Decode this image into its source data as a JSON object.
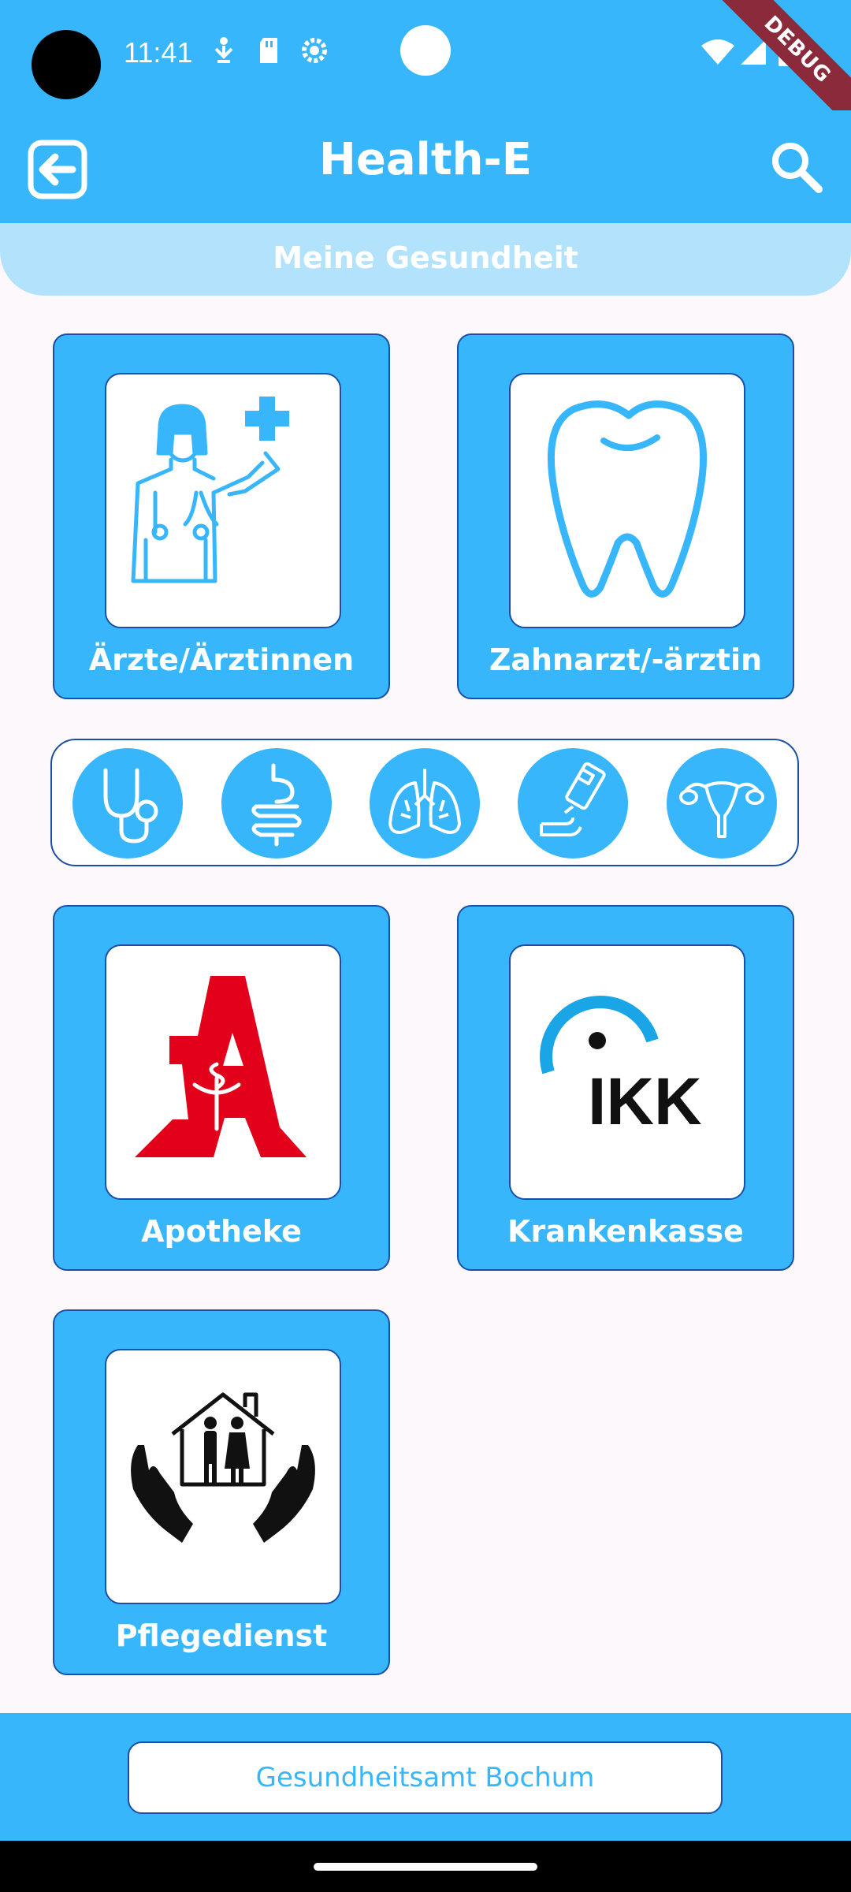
{
  "status_bar": {
    "time": "11:41",
    "debug_label": "DEBUG"
  },
  "app_bar": {
    "title": "Health-E",
    "back_icon": "back-arrow-icon",
    "search_icon": "search-icon"
  },
  "subheader": {
    "title": "Meine Gesundheit"
  },
  "cards": [
    {
      "label": "Ärzte/Ärztinnen",
      "icon": "doctor-icon"
    },
    {
      "label": "Zahnarzt/-ärztin",
      "icon": "tooth-icon"
    },
    {
      "label": "Apotheke",
      "icon": "pharmacy-logo"
    },
    {
      "label": "Krankenkasse",
      "icon": "ikk-logo",
      "logo_text": "IKK"
    },
    {
      "label": "Pflegedienst",
      "icon": "care-service-icon"
    }
  ],
  "specialties": [
    "stethoscope-icon",
    "digestive-system-icon",
    "lungs-icon",
    "glucose-meter-icon",
    "uterus-icon"
  ],
  "bottom": {
    "button_label": "Gesundheitsamt Bochum"
  },
  "colors": {
    "primary": "#38b6fb",
    "light": "#b3e2fd",
    "border": "#1a4fa8",
    "pharmacy_red": "#e2001a"
  }
}
